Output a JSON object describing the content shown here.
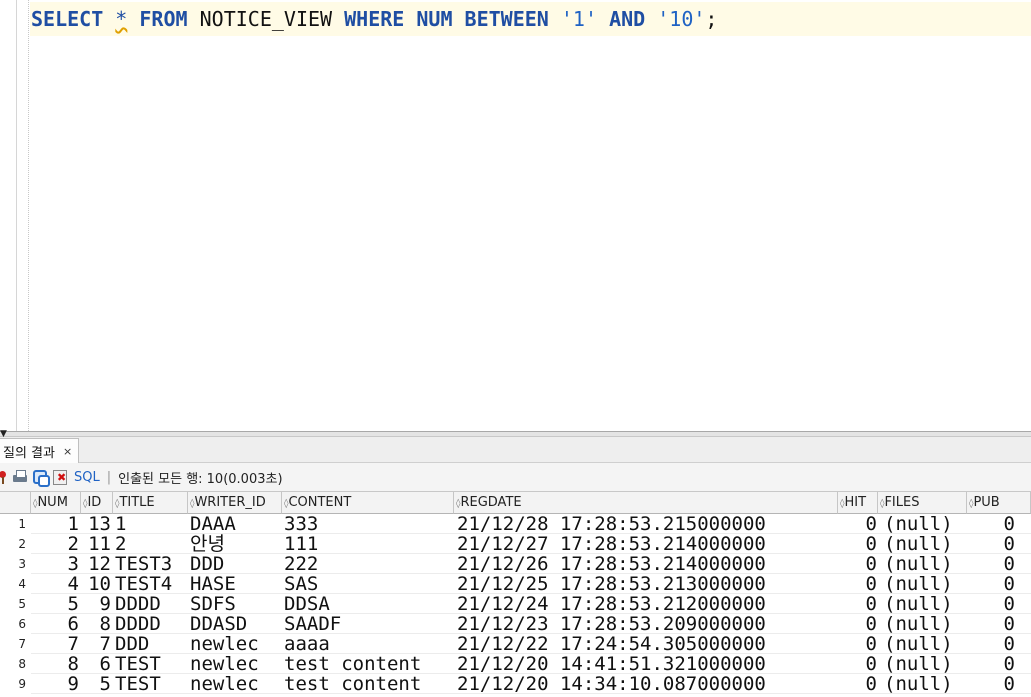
{
  "editor": {
    "kw_select": "SELECT",
    "star": "*",
    "kw_from": "FROM",
    "table": "NOTICE_VIEW",
    "kw_where": "WHERE",
    "col": "NUM",
    "kw_between": "BETWEEN",
    "lit1": "'1'",
    "kw_and": "AND",
    "lit2": "'10'",
    "semicolon": ";"
  },
  "result_tab": {
    "label": "질의 결과",
    "close": "×"
  },
  "toolbar": {
    "sql_label": "SQL",
    "separator": "|",
    "status": "인출된 모든 행: 10(0.003초)"
  },
  "columns": [
    "NUM",
    "ID",
    "TITLE",
    "WRITER_ID",
    "CONTENT",
    "REGDATE",
    "HIT",
    "FILES",
    "PUB"
  ],
  "rows": [
    [
      "1",
      "1",
      "13",
      "1",
      "DAAA",
      "333",
      "21/12/28 17:28:53.215000000",
      "0",
      "(null)",
      "0"
    ],
    [
      "2",
      "2",
      "11",
      "2",
      "안녕",
      "111",
      "21/12/27 17:28:53.214000000",
      "0",
      "(null)",
      "0"
    ],
    [
      "3",
      "3",
      "12",
      "TEST3",
      "DDD",
      "222",
      "21/12/26 17:28:53.214000000",
      "0",
      "(null)",
      "0"
    ],
    [
      "4",
      "4",
      "10",
      "TEST4",
      "HASE",
      "SAS",
      "21/12/25 17:28:53.213000000",
      "0",
      "(null)",
      "0"
    ],
    [
      "5",
      "5",
      "9",
      "DDDD",
      "SDFS",
      "DDSA",
      "21/12/24 17:28:53.212000000",
      "0",
      "(null)",
      "0"
    ],
    [
      "6",
      "6",
      "8",
      "DDDD",
      "DDASD",
      "SAADF",
      "21/12/23 17:28:53.209000000",
      "0",
      "(null)",
      "0"
    ],
    [
      "7",
      "7",
      "7",
      "DDD",
      "newlec",
      "aaaa",
      "21/12/22 17:24:54.305000000",
      "0",
      "(null)",
      "0"
    ],
    [
      "8",
      "8",
      "6",
      "TEST",
      "newlec",
      "test content",
      "21/12/20 14:41:51.321000000",
      "0",
      "(null)",
      "0"
    ],
    [
      "9",
      "9",
      "5",
      "TEST",
      "newlec",
      "test content",
      "21/12/20 14:34:10.087000000",
      "0",
      "(null)",
      "0"
    ]
  ]
}
